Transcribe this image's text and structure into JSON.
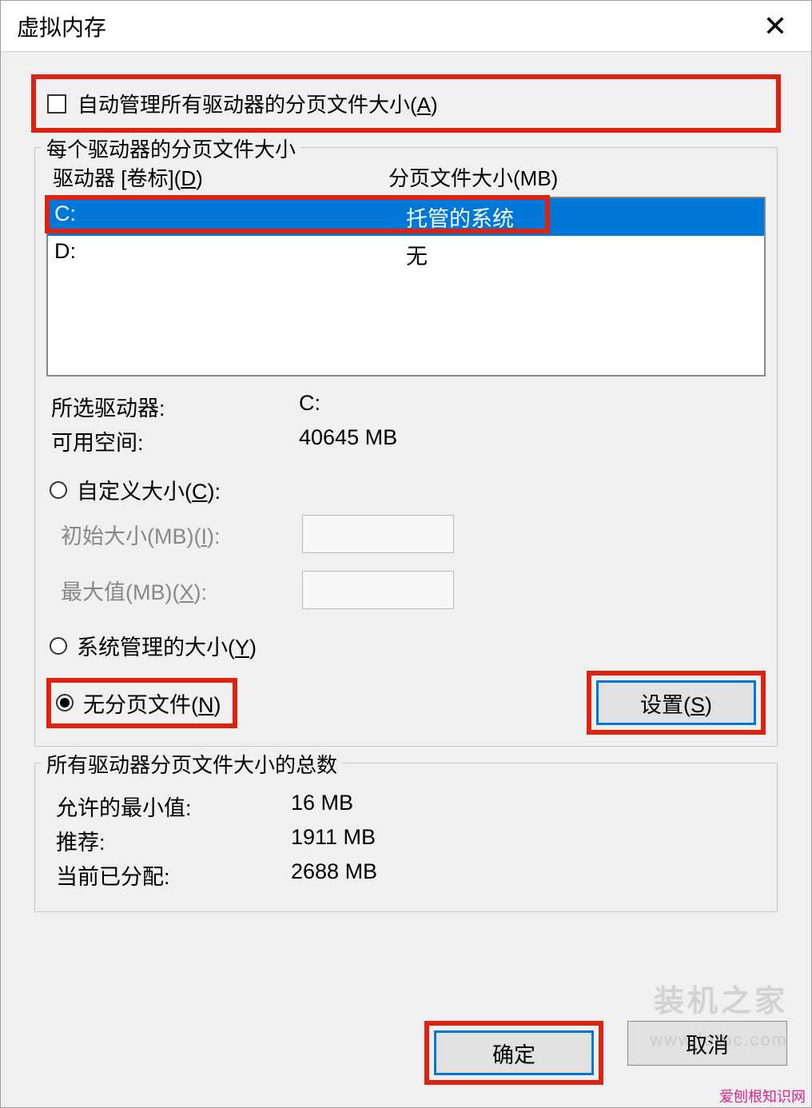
{
  "title": "虚拟内存",
  "auto_manage": {
    "label_prefix": "自动管理所有驱动器的分页文件大小(",
    "mnemonic": "A",
    "label_suffix": ")"
  },
  "drives_group": {
    "legend": "每个驱动器的分页文件大小",
    "header_drive_prefix": "驱动器 [卷标](",
    "header_drive_mnemonic": "D",
    "header_drive_suffix": ")",
    "header_size": "分页文件大小(MB)",
    "rows": [
      {
        "drive": "C:",
        "size": "托管的系统",
        "selected": true
      },
      {
        "drive": "D:",
        "size": "无",
        "selected": false
      }
    ],
    "selected_drive_label": "所选驱动器:",
    "selected_drive_value": "C:",
    "space_label": "可用空间:",
    "space_value": "40645 MB",
    "custom_prefix": "自定义大小(",
    "custom_mnemonic": "C",
    "custom_suffix": "):",
    "initial_prefix": "初始大小(MB)(",
    "initial_mnemonic": "I",
    "initial_suffix": "):",
    "max_prefix": "最大值(MB)(",
    "max_mnemonic": "X",
    "max_suffix": "):",
    "system_prefix": "系统管理的大小(",
    "system_mnemonic": "Y",
    "system_suffix": ")",
    "nopage_prefix": "无分页文件(",
    "nopage_mnemonic": "N",
    "nopage_suffix": ")",
    "set_prefix": "设置(",
    "set_mnemonic": "S",
    "set_suffix": ")"
  },
  "totals_group": {
    "legend": "所有驱动器分页文件大小的总数",
    "min_label": "允许的最小值:",
    "min_value": "16 MB",
    "rec_label": "推荐:",
    "rec_value": "1911 MB",
    "cur_label": "当前已分配:",
    "cur_value": "2688 MB"
  },
  "buttons": {
    "ok": "确定",
    "cancel": "取消"
  },
  "watermarks": {
    "w1": "装机之家",
    "w2": "www.lotpc.com",
    "w3": "爱刨根知识网"
  }
}
